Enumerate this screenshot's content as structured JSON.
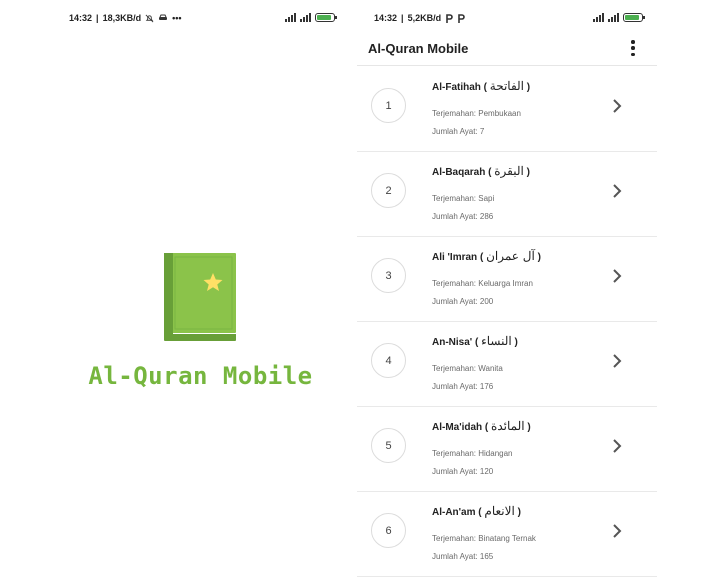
{
  "splash": {
    "status": {
      "time": "14:32",
      "speed": "18,3KB/d"
    },
    "app_title": "Al-Quran Mobile",
    "colors": {
      "book": "#8bc34a",
      "book_dark": "#689f38",
      "moon": "#ffe066",
      "title": "#76b63e"
    },
    "icon": "quran-book-icon"
  },
  "list_screen": {
    "status": {
      "time": "14:32",
      "speed": "5,2KB/d"
    },
    "appbar": {
      "title": "Al-Quran Mobile",
      "menu_icon": "more-vert-icon"
    },
    "surah_list": [
      {
        "number": "1",
        "name": "Al-Fatihah",
        "arabic": "الفاتحة",
        "translation": "Terjemahan: Pembukaan",
        "ayat": "Jumlah Ayat: 7"
      },
      {
        "number": "2",
        "name": "Al-Baqarah",
        "arabic": "البقرة",
        "translation": "Terjemahan: Sapi",
        "ayat": "Jumlah Ayat: 286"
      },
      {
        "number": "3",
        "name": "Ali 'Imran",
        "arabic": "آل عمران",
        "translation": "Terjemahan: Keluarga Imran",
        "ayat": "Jumlah Ayat: 200"
      },
      {
        "number": "4",
        "name": "An-Nisa'",
        "arabic": "النساء",
        "translation": "Terjemahan: Wanita",
        "ayat": "Jumlah Ayat: 176"
      },
      {
        "number": "5",
        "name": "Al-Ma'idah",
        "arabic": "المائدة",
        "translation": "Terjemahan: Hidangan",
        "ayat": "Jumlah Ayat: 120"
      },
      {
        "number": "6",
        "name": "Al-An'am",
        "arabic": "الانعام",
        "translation": "Terjemahan: Binatang Ternak",
        "ayat": "Jumlah Ayat: 165"
      }
    ]
  }
}
